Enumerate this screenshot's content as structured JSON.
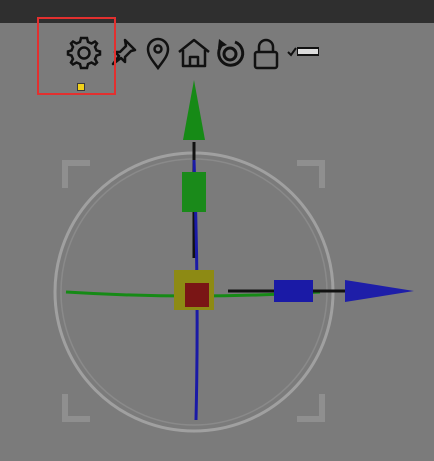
{
  "toolbar": {
    "tools": [
      {
        "id": "settings",
        "icon": "gear-icon",
        "active": true
      },
      {
        "id": "pin",
        "icon": "pushpin-icon",
        "active": false
      },
      {
        "id": "location",
        "icon": "map-pin-icon",
        "active": false
      },
      {
        "id": "home",
        "icon": "home-icon",
        "active": false
      },
      {
        "id": "reset",
        "icon": "rotate-reset-icon",
        "active": false
      },
      {
        "id": "lock",
        "icon": "padlock-icon",
        "active": false
      },
      {
        "id": "checkbox",
        "icon": "checkbox-slider-icon",
        "active": false
      }
    ]
  },
  "gizmo": {
    "axes": {
      "x": {
        "color": "#1a1aa6",
        "arrow": "cone"
      },
      "y": {
        "color": "#1e8a1e",
        "arrow": "cone"
      },
      "z": {
        "color": "#1a1aa6"
      }
    },
    "center": {
      "color": "#7a1515",
      "handle_color": "#8d8a14"
    },
    "ring_color": "#a3a3a3",
    "corner_bracket_color": "#8f8f8f"
  },
  "colors": {
    "background": "#7b7b7b",
    "top_bar": "#2f2f2f",
    "selection_outline": "#e3302f",
    "selection_marker": "#f2d21a"
  }
}
